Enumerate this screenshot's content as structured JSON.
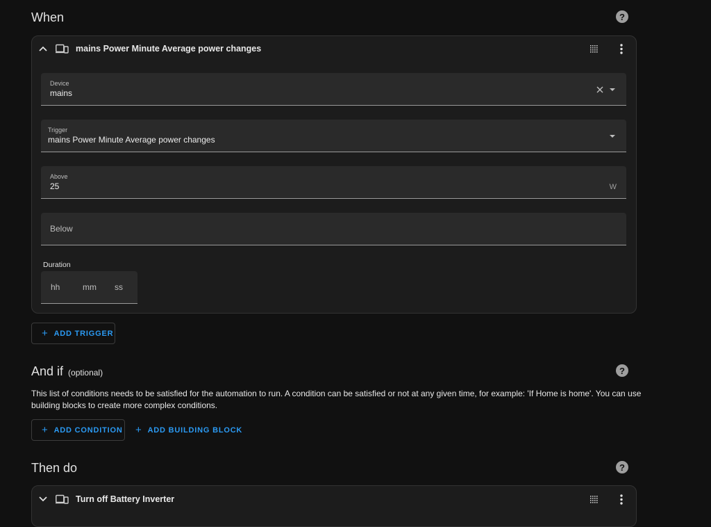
{
  "when": {
    "title": "When",
    "trigger_card": {
      "title": "mains Power Minute Average power changes",
      "device_field": {
        "label": "Device",
        "value": "mains"
      },
      "trigger_field": {
        "label": "Trigger",
        "value": "mains Power Minute Average power changes"
      },
      "above_field": {
        "label": "Above",
        "value": "25",
        "unit": "W"
      },
      "below_field": {
        "placeholder": "Below"
      },
      "duration": {
        "label": "Duration",
        "hh": "hh",
        "mm": "mm",
        "ss": "ss"
      }
    },
    "add_trigger_label": "ADD TRIGGER"
  },
  "and_if": {
    "title": "And if",
    "optional": "(optional)",
    "description": "This list of conditions needs to be satisfied for the automation to run. A condition can be satisfied or not at any given time, for example: 'If Home is home'. You can use building blocks to create more complex conditions.",
    "add_condition_label": "ADD CONDITION",
    "add_building_block_label": "ADD BUILDING BLOCK"
  },
  "then_do": {
    "title": "Then do",
    "action_card": {
      "title": "Turn off Battery Inverter"
    }
  },
  "icons": {
    "help": "help-circle-icon",
    "chevron_up": "chevron-up-icon",
    "chevron_down": "chevron-down-icon",
    "device": "devices-icon",
    "drag": "drag-grid-icon",
    "menu": "dots-vertical-icon",
    "clear": "close-icon",
    "dropdown": "menu-down-icon",
    "plus": "plus-icon"
  },
  "colors": {
    "background": "#111111",
    "card": "#1c1c1c",
    "field": "#2a2a2a",
    "accent": "#2b9af3"
  }
}
